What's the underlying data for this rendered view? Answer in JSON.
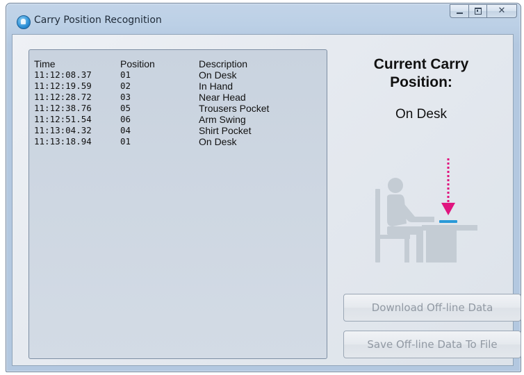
{
  "window": {
    "title": "Carry Position Recognition",
    "close_glyph": "✕"
  },
  "log": {
    "headers": {
      "time": "Time",
      "position": "Position",
      "description": "Description"
    },
    "rows": [
      {
        "time": "11:12:08.37",
        "position": "01",
        "description": "On Desk"
      },
      {
        "time": "11:12:19.59",
        "position": "02",
        "description": "In Hand"
      },
      {
        "time": "11:12:28.72",
        "position": "03",
        "description": "Near Head"
      },
      {
        "time": "11:12:38.76",
        "position": "05",
        "description": "Trousers Pocket"
      },
      {
        "time": "11:12:51.54",
        "position": "06",
        "description": "Arm Swing"
      },
      {
        "time": "11:13:04.32",
        "position": "04",
        "description": "Shirt Pocket"
      },
      {
        "time": "11:13:18.94",
        "position": "01",
        "description": "On Desk"
      }
    ]
  },
  "current": {
    "heading_line1": "Current Carry",
    "heading_line2": "Position:",
    "value": "On Desk",
    "illustration_icon": "person-at-desk-icon"
  },
  "buttons": {
    "download_label": "Download Off-line Data",
    "save_label": "Save Off-line Data To File"
  },
  "colors": {
    "arrow": "#e0157f",
    "device": "#2a9ad8",
    "figure": "#c4ccd4"
  }
}
